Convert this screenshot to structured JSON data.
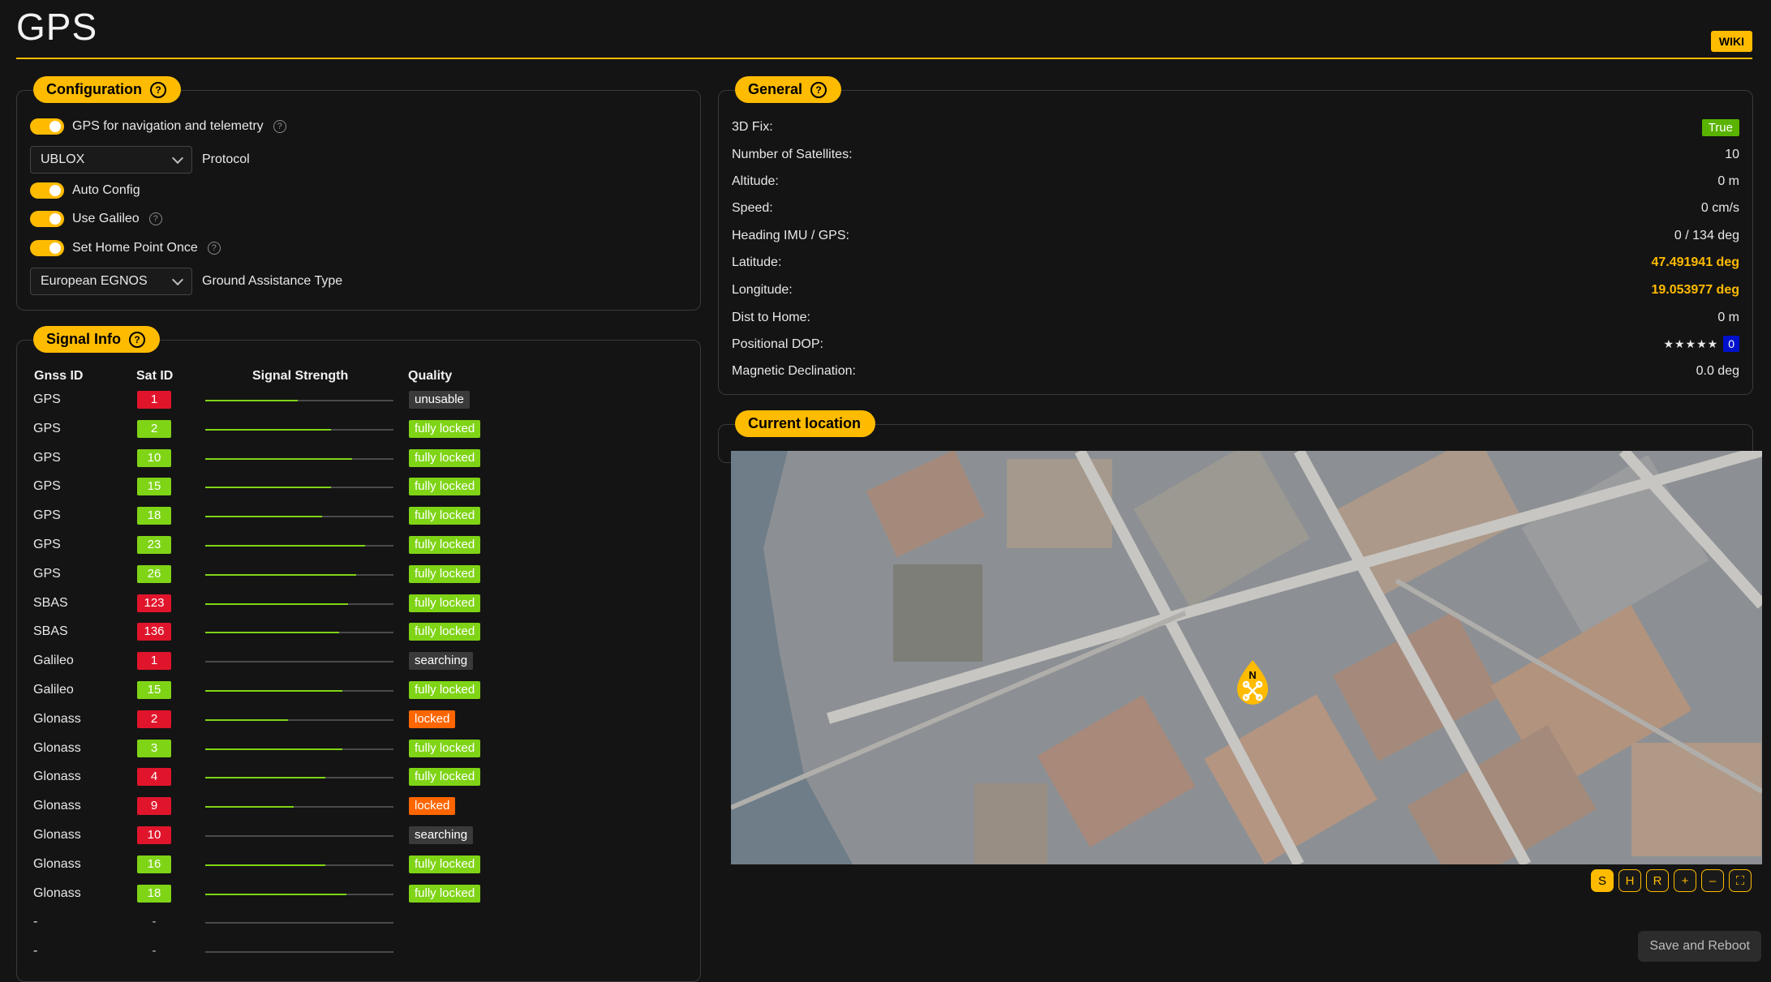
{
  "page": {
    "title": "GPS",
    "wiki_label": "WIKI"
  },
  "colors": {
    "accent": "#ffbb00",
    "green": "#7fd416",
    "red": "#e0152b",
    "orange": "#ff6600",
    "gray": "#3a3a3a"
  },
  "configuration": {
    "header": "Configuration",
    "gps_nav_label": "GPS for navigation and telemetry",
    "protocol_value": "UBLOX",
    "protocol_label": "Protocol",
    "auto_config_label": "Auto Config",
    "use_galileo_label": "Use Galileo",
    "home_point_label": "Set Home Point Once",
    "assistance_value": "European EGNOS",
    "assistance_label": "Ground Assistance Type"
  },
  "signal_info": {
    "header": "Signal Info",
    "col_gnss": "Gnss ID",
    "col_sat": "Sat ID",
    "col_strength": "Signal Strength",
    "col_quality": "Quality",
    "rows": [
      {
        "gnss": "GPS",
        "sat": "1",
        "sat_color": "red",
        "strength": 0.49,
        "quality": "unusable",
        "q_color": "gray"
      },
      {
        "gnss": "GPS",
        "sat": "2",
        "sat_color": "green",
        "strength": 0.67,
        "quality": "fully locked",
        "q_color": "green"
      },
      {
        "gnss": "GPS",
        "sat": "10",
        "sat_color": "green",
        "strength": 0.78,
        "quality": "fully locked",
        "q_color": "green"
      },
      {
        "gnss": "GPS",
        "sat": "15",
        "sat_color": "green",
        "strength": 0.67,
        "quality": "fully locked",
        "q_color": "green"
      },
      {
        "gnss": "GPS",
        "sat": "18",
        "sat_color": "green",
        "strength": 0.62,
        "quality": "fully locked",
        "q_color": "green"
      },
      {
        "gnss": "GPS",
        "sat": "23",
        "sat_color": "green",
        "strength": 0.85,
        "quality": "fully locked",
        "q_color": "green"
      },
      {
        "gnss": "GPS",
        "sat": "26",
        "sat_color": "green",
        "strength": 0.8,
        "quality": "fully locked",
        "q_color": "green"
      },
      {
        "gnss": "SBAS",
        "sat": "123",
        "sat_color": "red",
        "strength": 0.76,
        "quality": "fully locked",
        "q_color": "green"
      },
      {
        "gnss": "SBAS",
        "sat": "136",
        "sat_color": "red",
        "strength": 0.71,
        "quality": "fully locked",
        "q_color": "green"
      },
      {
        "gnss": "Galileo",
        "sat": "1",
        "sat_color": "red",
        "strength": 0.0,
        "quality": "searching",
        "q_color": "gray"
      },
      {
        "gnss": "Galileo",
        "sat": "15",
        "sat_color": "green",
        "strength": 0.73,
        "quality": "fully locked",
        "q_color": "green"
      },
      {
        "gnss": "Glonass",
        "sat": "2",
        "sat_color": "red",
        "strength": 0.44,
        "quality": "locked",
        "q_color": "orange"
      },
      {
        "gnss": "Glonass",
        "sat": "3",
        "sat_color": "green",
        "strength": 0.73,
        "quality": "fully locked",
        "q_color": "green"
      },
      {
        "gnss": "Glonass",
        "sat": "4",
        "sat_color": "red",
        "strength": 0.64,
        "quality": "fully locked",
        "q_color": "green"
      },
      {
        "gnss": "Glonass",
        "sat": "9",
        "sat_color": "red",
        "strength": 0.47,
        "quality": "locked",
        "q_color": "orange"
      },
      {
        "gnss": "Glonass",
        "sat": "10",
        "sat_color": "red",
        "strength": 0.0,
        "quality": "searching",
        "q_color": "gray"
      },
      {
        "gnss": "Glonass",
        "sat": "16",
        "sat_color": "green",
        "strength": 0.64,
        "quality": "fully locked",
        "q_color": "green"
      },
      {
        "gnss": "Glonass",
        "sat": "18",
        "sat_color": "green",
        "strength": 0.75,
        "quality": "fully locked",
        "q_color": "green"
      },
      {
        "gnss": "-",
        "sat": "-",
        "sat_color": "none",
        "strength": 0.0,
        "quality": "",
        "q_color": "none"
      },
      {
        "gnss": "-",
        "sat": "-",
        "sat_color": "none",
        "strength": 0.0,
        "quality": "",
        "q_color": "none"
      }
    ]
  },
  "general": {
    "header": "General",
    "fix_label": "3D Fix:",
    "fix_value": "True",
    "sats_label": "Number of Satellites:",
    "sats_value": "10",
    "alt_label": "Altitude:",
    "alt_value": "0 m",
    "speed_label": "Speed:",
    "speed_value": "0 cm/s",
    "heading_label": "Heading IMU / GPS:",
    "heading_value": "0 / 134 deg",
    "lat_label": "Latitude:",
    "lat_value": "47.491941 deg",
    "lon_label": "Longitude:",
    "lon_value": "19.053977 deg",
    "home_label": "Dist to Home:",
    "home_value": "0 m",
    "dop_label": "Positional DOP:",
    "dop_stars": "★★★★★",
    "dop_value": "0",
    "mag_label": "Magnetic Declination:",
    "mag_value": "0.0 deg"
  },
  "location": {
    "header": "Current location",
    "marker_letter": "N",
    "controls": [
      "S",
      "H",
      "R",
      "+",
      "–",
      "⛶"
    ]
  },
  "save_label": "Save and Reboot"
}
